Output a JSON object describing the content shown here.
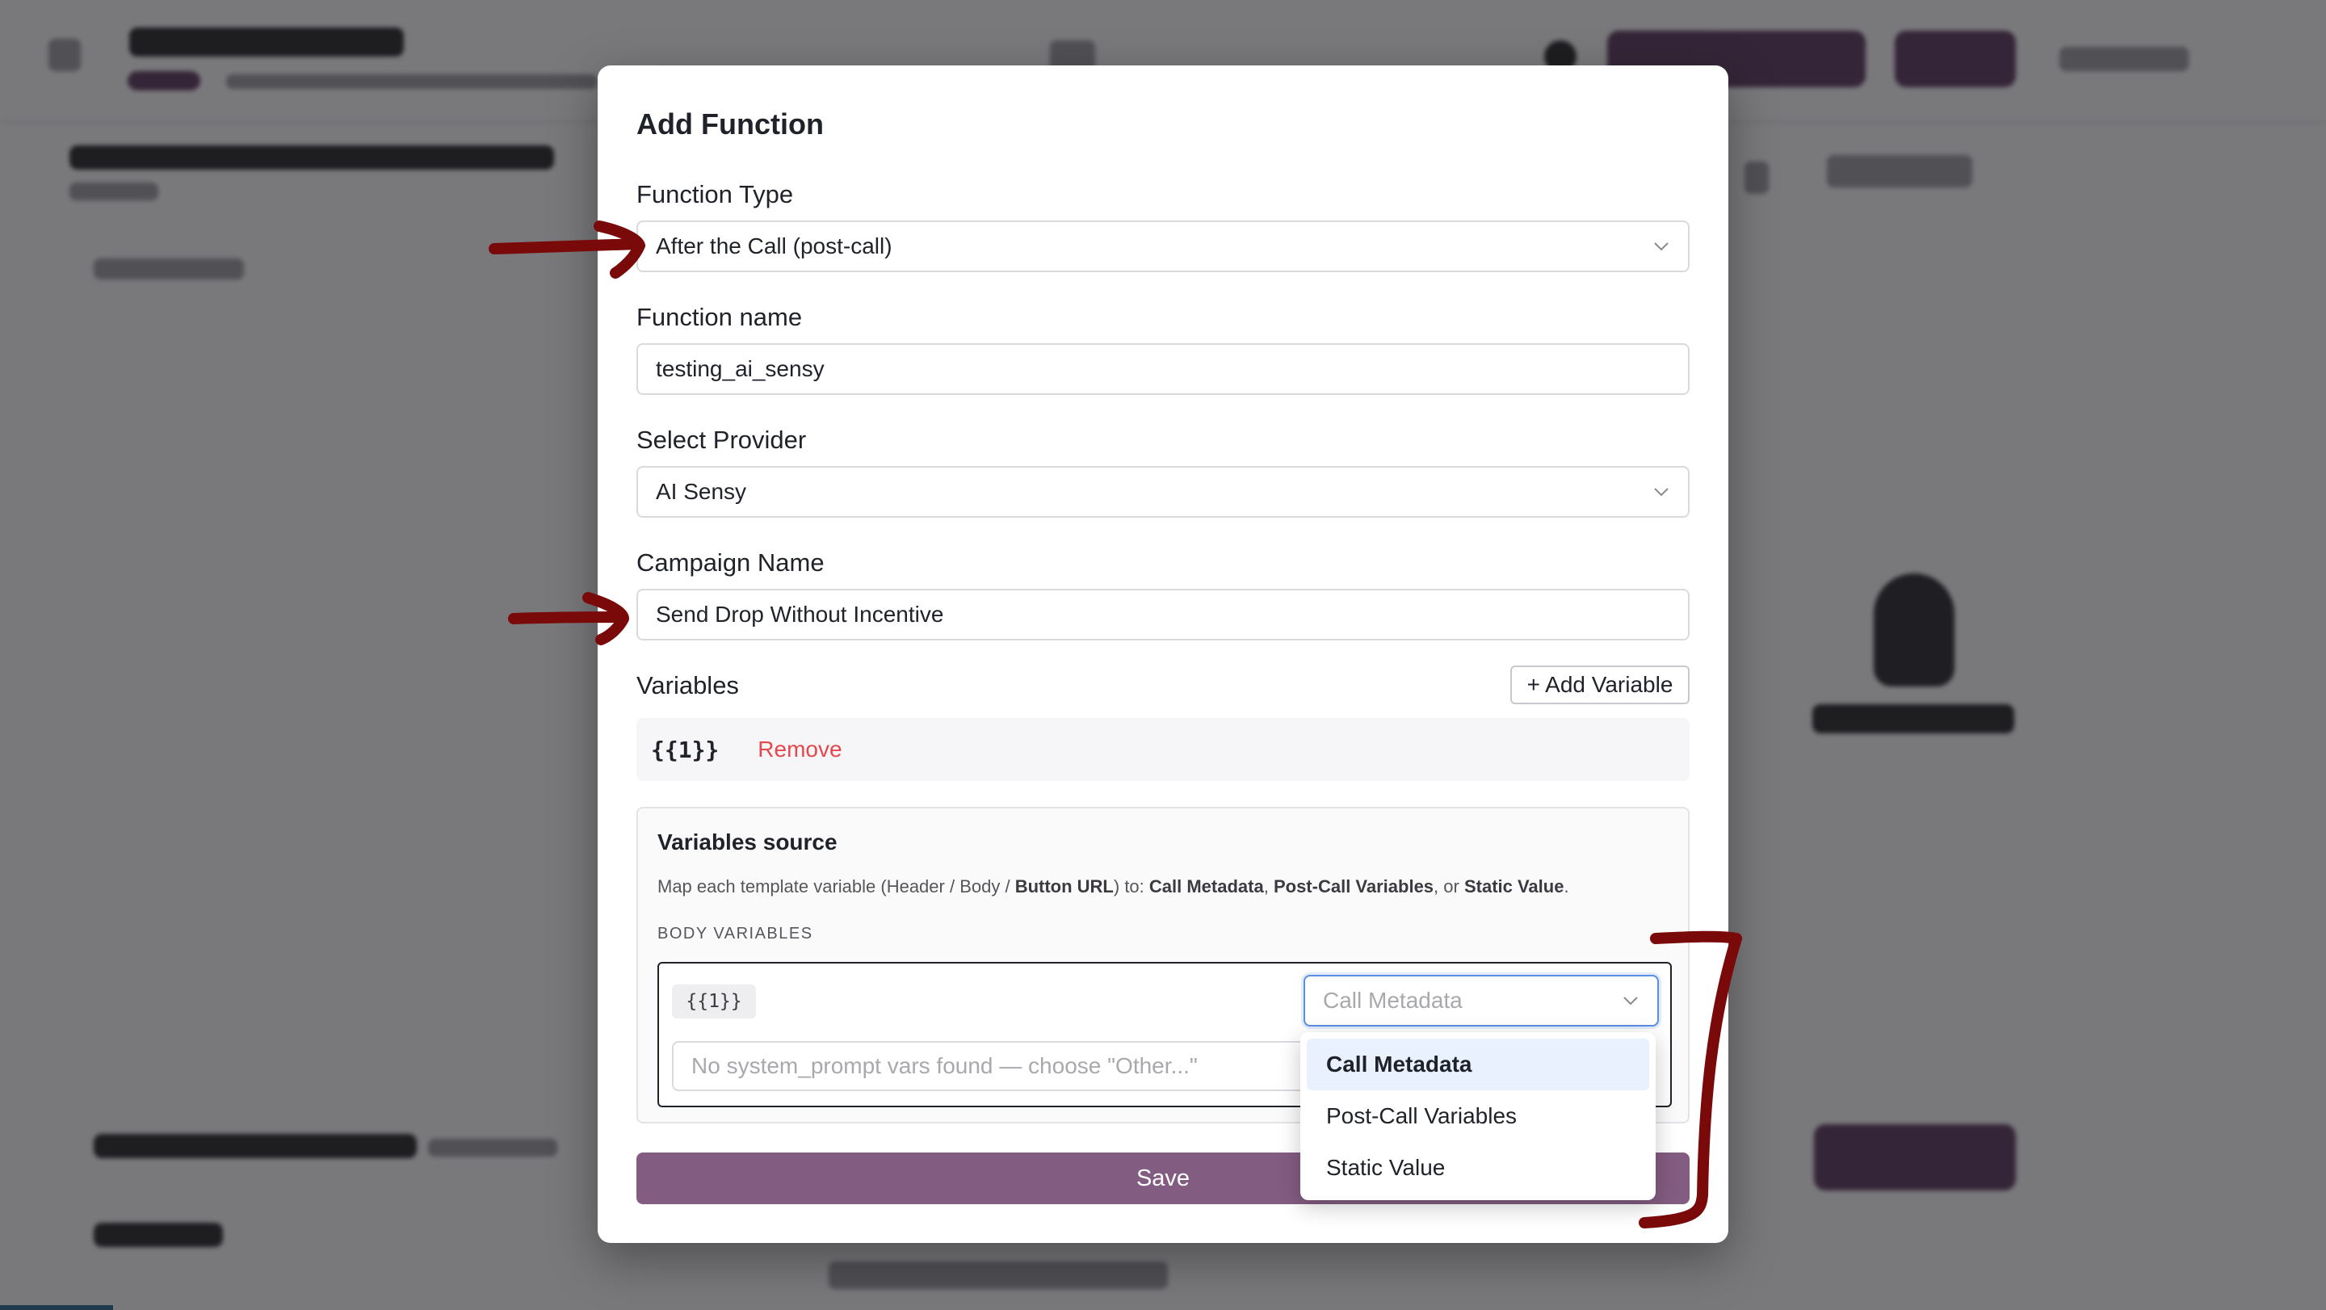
{
  "modal": {
    "title": "Add Function",
    "function_type": {
      "label": "Function Type",
      "value": "After the Call (post-call)"
    },
    "function_name": {
      "label": "Function name",
      "value": "testing_ai_sensy"
    },
    "provider": {
      "label": "Select Provider",
      "value": "AI Sensy"
    },
    "campaign": {
      "label": "Campaign Name",
      "value": "Send Drop Without Incentive"
    },
    "variables": {
      "label": "Variables",
      "add_button": "+ Add Variable",
      "items": [
        {
          "token": "{{1}}",
          "remove_label": "Remove"
        }
      ]
    },
    "variables_source": {
      "title": "Variables source",
      "desc_prefix": "Map each template variable (Header / Body / ",
      "desc_button_url": "Button URL",
      "desc_mid": ") to: ",
      "desc_call_metadata": "Call Metadata",
      "desc_comma": ", ",
      "desc_post_call": "Post-Call Variables",
      "desc_or": ", or ",
      "desc_static": "Static Value",
      "desc_end": ".",
      "body_variables_label": "BODY VARIABLES",
      "body_var_token": "{{1}}",
      "source_select_placeholder": "Call Metadata",
      "system_prompt_placeholder": "No system_prompt vars found — choose \"Other...\""
    },
    "save_label": "Save"
  },
  "dropdown": {
    "options": [
      "Call Metadata",
      "Post-Call Variables",
      "Static Value"
    ],
    "highlighted": "Call Metadata"
  },
  "colors": {
    "primary": "#835c82",
    "annotation": "#7a0a0a",
    "remove": "#e5484d",
    "focus": "#5a8ee6"
  }
}
